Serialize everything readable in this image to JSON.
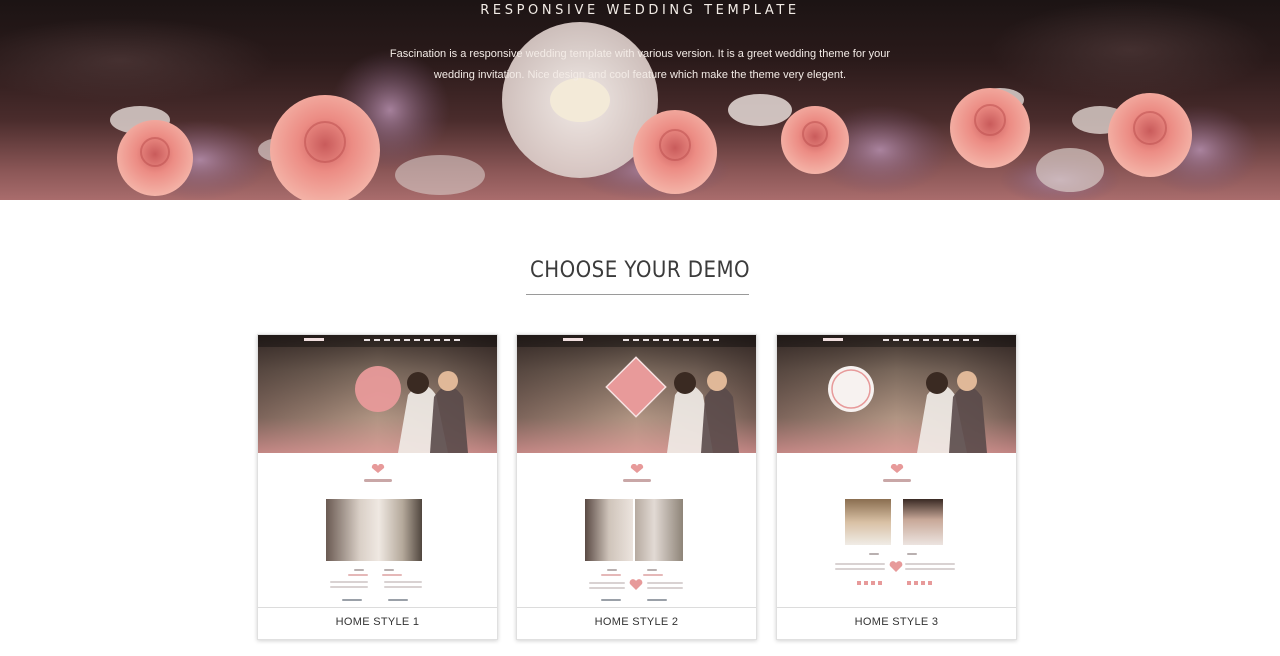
{
  "hero": {
    "title": "RESPONSIVE WEDDING TEMPLATE",
    "description_line1": "Fascination is a responsive wedding template with various version. It is a greet wedding theme for your",
    "description_line2": "wedding invitation. Nice design and cool feature which make the theme very elegent."
  },
  "section": {
    "title": "CHOOSE YOUR DEMO"
  },
  "demos": [
    {
      "label": "HOME STYLE 1",
      "badge_shape": "circle",
      "photo": "couple-kiss"
    },
    {
      "label": "HOME STYLE 2",
      "badge_shape": "diamond",
      "photo": "couple-kiss"
    },
    {
      "label": "HOME STYLE 3",
      "badge_shape": "ring",
      "photo": "bride-groom-portraits"
    }
  ],
  "colors": {
    "accent_pink": "#e79a9a",
    "hero_dark": "#1c1414",
    "text_dark": "#3b3b3b"
  }
}
